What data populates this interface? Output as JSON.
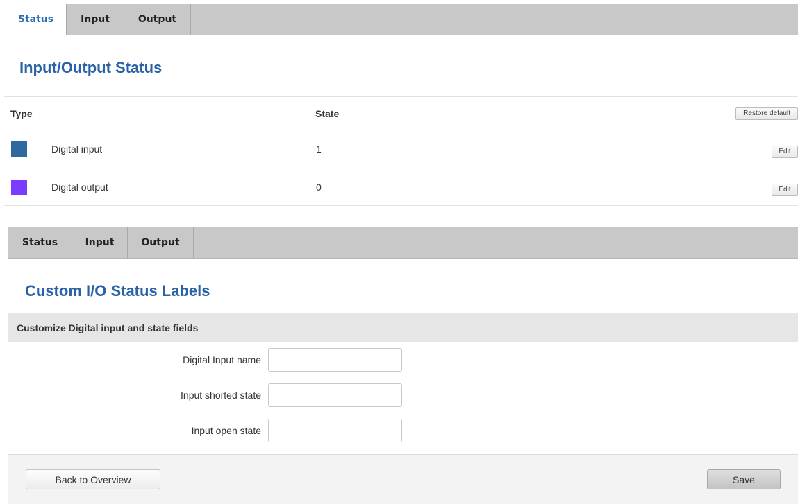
{
  "tabs_top": [
    {
      "label": "Status",
      "active": true
    },
    {
      "label": "Input",
      "active": false
    },
    {
      "label": "Output",
      "active": false
    }
  ],
  "status_section": {
    "title": "Input/Output Status",
    "columns": {
      "type": "Type",
      "state": "State"
    },
    "restore_label": "Restore default",
    "rows": [
      {
        "color": "#2e6aa1",
        "name": "Digital input",
        "state": "1",
        "edit_label": "Edit"
      },
      {
        "color": "#7a3cff",
        "name": "Digital output",
        "state": "0",
        "edit_label": "Edit"
      }
    ]
  },
  "tabs_bottom": [
    {
      "label": "Status",
      "active": false
    },
    {
      "label": "Input",
      "active": false
    },
    {
      "label": "Output",
      "active": false
    }
  ],
  "labels_section": {
    "title": "Custom I/O Status Labels",
    "group_header": "Customize Digital input and state fields",
    "fields": [
      {
        "label": "Digital Input name",
        "value": ""
      },
      {
        "label": "Input shorted state",
        "value": ""
      },
      {
        "label": "Input open state",
        "value": ""
      }
    ]
  },
  "footer": {
    "back_label": "Back to Overview",
    "save_label": "Save"
  }
}
